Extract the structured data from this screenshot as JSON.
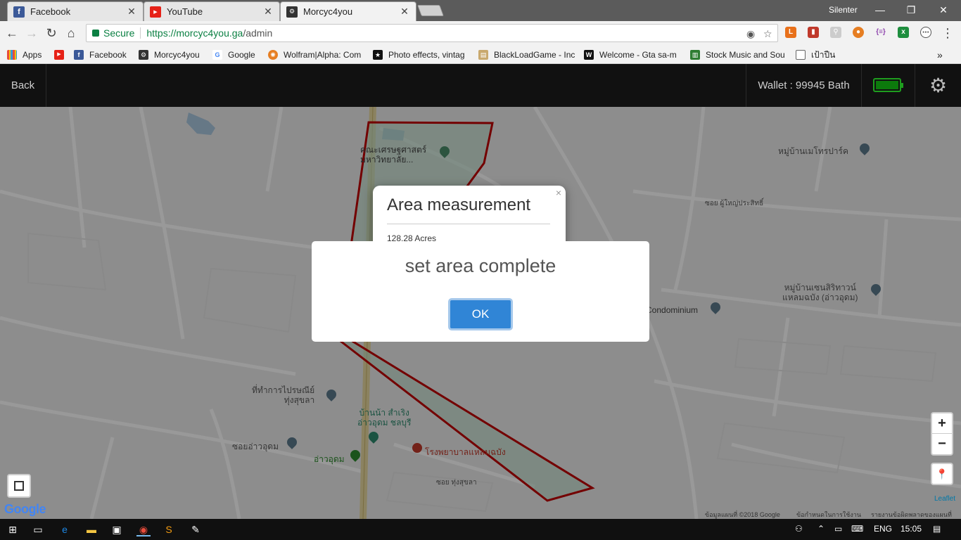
{
  "browser": {
    "tabs": [
      {
        "label": "Facebook",
        "icon": "facebook-icon",
        "color": "#3b5998",
        "glyph": "f"
      },
      {
        "label": "YouTube",
        "icon": "youtube-icon",
        "color": "#e62117",
        "glyph": "▶"
      },
      {
        "label": "Morcyc4you",
        "icon": "motorcycle-icon",
        "color": "#333333",
        "glyph": "🏍"
      }
    ],
    "profile": "Silenter",
    "secure_label": "Secure",
    "url_host": "https://morcyc4you.ga",
    "url_path": "/admin"
  },
  "bookmarks": [
    {
      "label": "Apps",
      "icon": "apps-icon"
    },
    {
      "label": "",
      "icon": "youtube-icon"
    },
    {
      "label": "Facebook",
      "icon": "facebook-icon"
    },
    {
      "label": "Morcyc4you",
      "icon": "motorcycle-icon"
    },
    {
      "label": "Google",
      "icon": "google-icon"
    },
    {
      "label": "Wolfram|Alpha: Com",
      "icon": "wolfram-icon"
    },
    {
      "label": "Photo effects, vintag",
      "icon": "star-icon"
    },
    {
      "label": "BlackLoadGame - Inc",
      "icon": "game-icon"
    },
    {
      "label": "Welcome - Gta sa-m",
      "icon": "w-icon"
    },
    {
      "label": "Stock Music and Sou",
      "icon": "music-icon"
    },
    {
      "label": "เป้าปืน",
      "icon": "page-icon"
    }
  ],
  "app": {
    "back_label": "Back",
    "wallet_text": "Wallet : 99945 Bath",
    "battery_level": 1.0
  },
  "map": {
    "labels": [
      {
        "text": "คณะเศรษฐศาสตร์\nมหาวิทยาลัย...",
        "key": "faculty"
      },
      {
        "text": "หมู่บ้านเมโทรปาร์ค",
        "key": "metropark"
      },
      {
        "text": "ซอย ผู้ใหญ่ประสิทธิ์",
        "key": "soi-puyai"
      },
      {
        "text": "หมู่บ้านเซนสิริทาวน์\nแหลมฉบัง (อ่าวอุดม)",
        "key": "sensiri"
      },
      {
        "text": "Condominium",
        "key": "condo"
      },
      {
        "text": "ที่ทำการไปรษณีย์\nทุ่งสุขลา",
        "key": "postoffice"
      },
      {
        "text": "บ้านน้า สำเริง\nอ่าวอุดม ชลบุรี",
        "key": "house"
      },
      {
        "text": "โรงพยาบาลแหลมฉบัง",
        "key": "hospital"
      },
      {
        "text": "ซอยอ่าวอุดม",
        "key": "soi-aoudom"
      },
      {
        "text": "อ่าวอุดม",
        "key": "aoudom"
      },
      {
        "text": "ซอย ทุ่งสุขลา",
        "key": "soi-thung"
      }
    ],
    "attribution": "ข้อมูลแผนที่ ©2018 Google",
    "terms": "ข้อกำหนดในการใช้งาน",
    "report": "รายงานข้อผิดพลาดของแผนที่",
    "leaflet": "Leaflet",
    "google_logo": "Google",
    "zoom_in": "+",
    "zoom_out": "−"
  },
  "popup": {
    "title": "Area measurement",
    "value": "128.28 Acres",
    "close": "×"
  },
  "modal": {
    "title": "set area complete",
    "ok_label": "OK"
  },
  "taskbar": {
    "lang": "ENG",
    "time": "15:05"
  }
}
